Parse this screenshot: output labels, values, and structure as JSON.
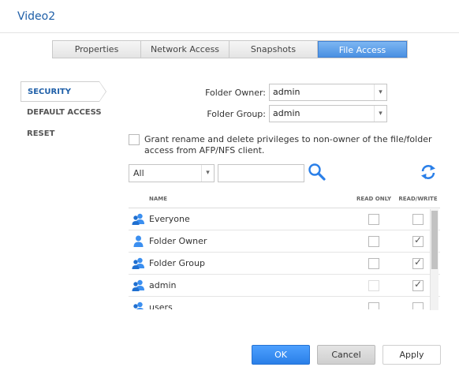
{
  "window": {
    "title": "Video2"
  },
  "tabs": [
    {
      "label": "Properties",
      "active": false
    },
    {
      "label": "Network Access",
      "active": false
    },
    {
      "label": "Snapshots",
      "active": false
    },
    {
      "label": "File Access",
      "active": true
    }
  ],
  "sidebar": {
    "items": [
      {
        "label": "SECURITY",
        "active": true
      },
      {
        "label": "DEFAULT ACCESS",
        "active": false
      },
      {
        "label": "RESET",
        "active": false
      }
    ]
  },
  "folder_owner": {
    "label": "Folder Owner:",
    "value": "admin"
  },
  "folder_group": {
    "label": "Folder Group:",
    "value": "admin"
  },
  "grant": {
    "checked": false,
    "text": "Grant rename and delete privileges to non-owner of the file/folder access from AFP/NFS client."
  },
  "filter": {
    "value": "All",
    "search_value": ""
  },
  "table": {
    "columns": {
      "name": "NAME",
      "read_only": "READ ONLY",
      "read_write": "READ/WRITE"
    },
    "rows": [
      {
        "name": "Everyone",
        "icon": "group-icon",
        "read_only": false,
        "read_write": false,
        "read_only_disabled": false
      },
      {
        "name": "Folder Owner",
        "icon": "user-icon",
        "read_only": false,
        "read_write": true,
        "read_only_disabled": false
      },
      {
        "name": "Folder Group",
        "icon": "group-icon",
        "read_only": false,
        "read_write": true,
        "read_only_disabled": false
      },
      {
        "name": "admin",
        "icon": "group-icon",
        "read_only": false,
        "read_write": true,
        "read_only_disabled": true
      },
      {
        "name": "users",
        "icon": "group-icon",
        "read_only": false,
        "read_write": false,
        "read_only_disabled": false
      }
    ]
  },
  "buttons": {
    "ok": "OK",
    "cancel": "Cancel",
    "apply": "Apply"
  },
  "colors": {
    "accent": "#2a7fe8",
    "title": "#1f5fa8",
    "icon": "#3b8ff0"
  }
}
